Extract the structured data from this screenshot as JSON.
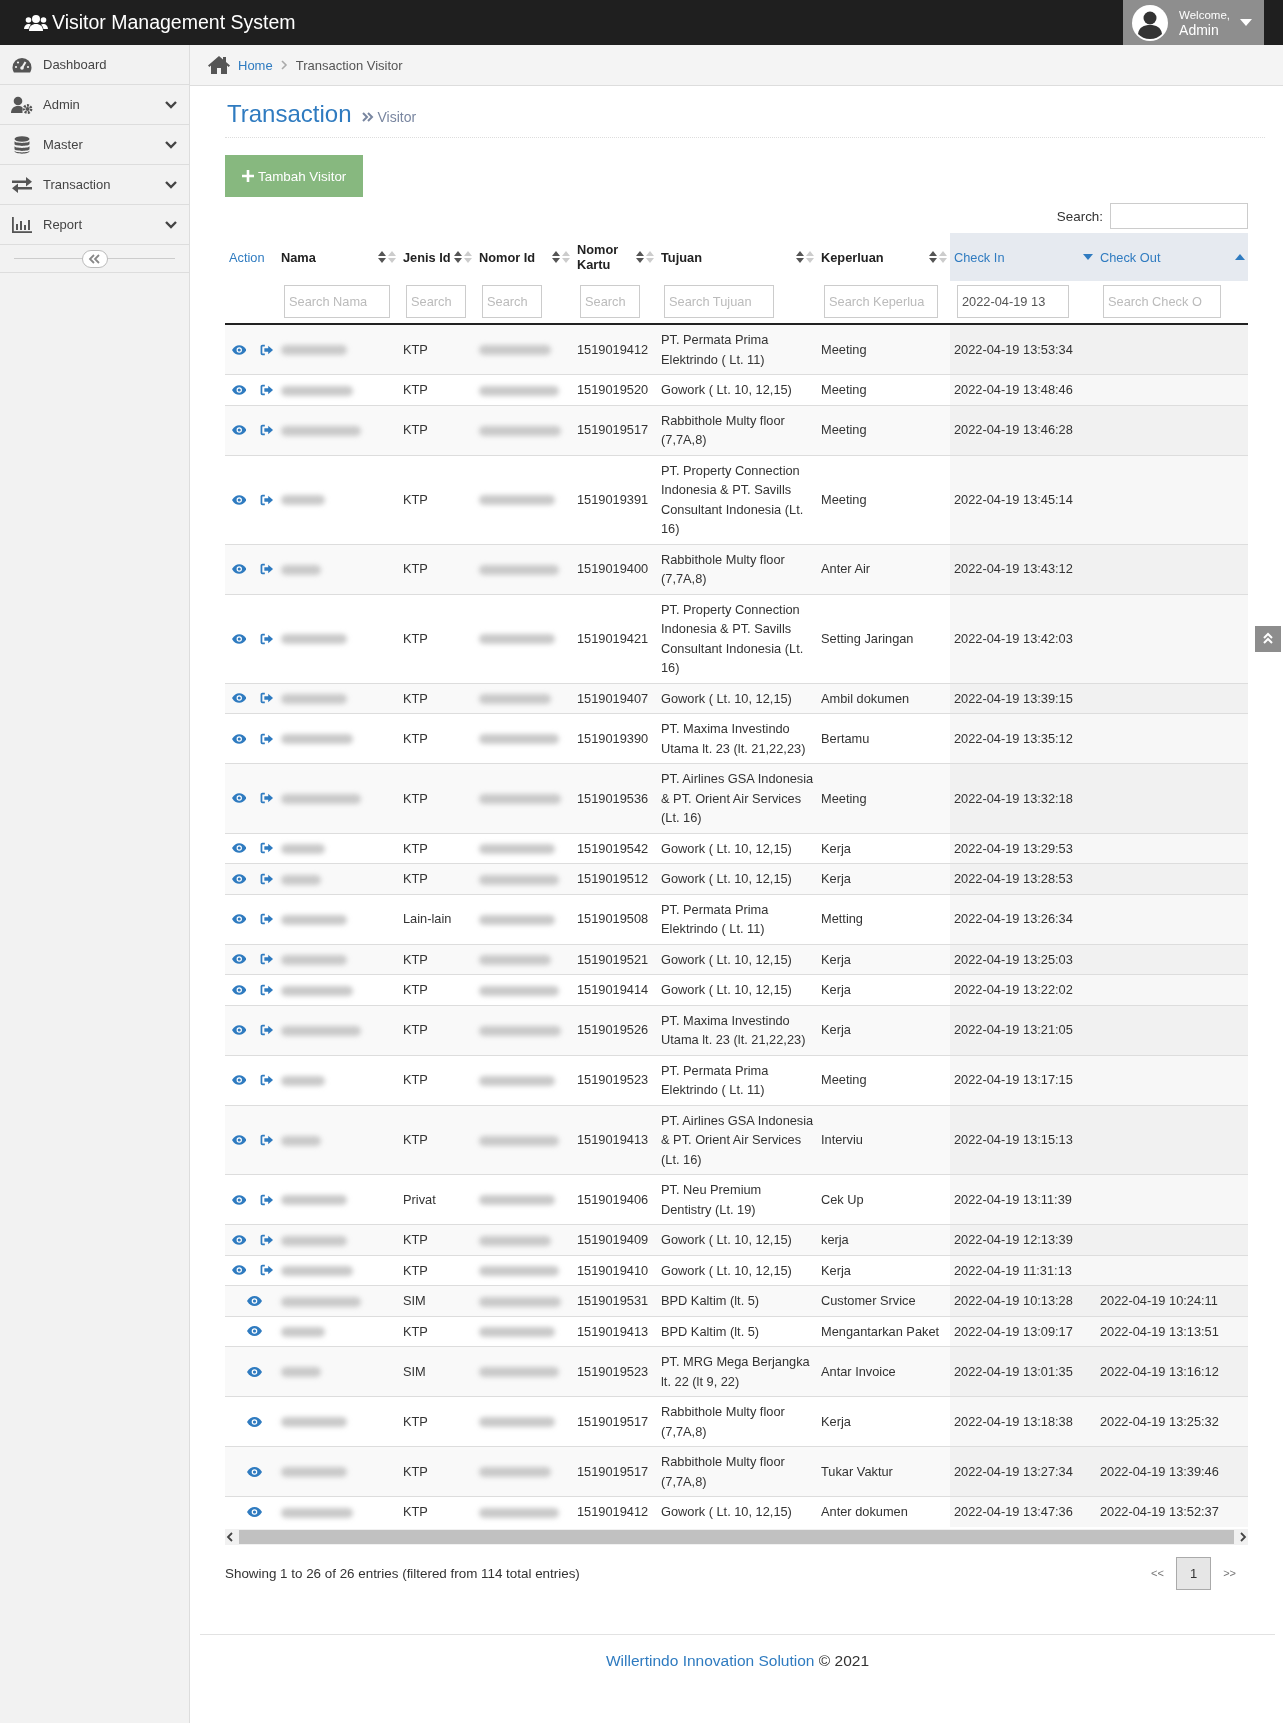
{
  "app": {
    "title": "Visitor Management System"
  },
  "user": {
    "greeting": "Welcome,",
    "name": "Admin"
  },
  "sidebar": {
    "items": [
      {
        "label": "Dashboard",
        "expandable": false
      },
      {
        "label": "Admin",
        "expandable": true
      },
      {
        "label": "Master",
        "expandable": true
      },
      {
        "label": "Transaction",
        "expandable": true
      },
      {
        "label": "Report",
        "expandable": true
      }
    ]
  },
  "breadcrumb": [
    {
      "label": "Home",
      "link": true
    },
    {
      "label": "Transaction Visitor",
      "link": false
    }
  ],
  "page": {
    "title": "Transaction",
    "subtitle": "Visitor"
  },
  "add_button": "Tambah Visitor",
  "search": {
    "label": "Search:"
  },
  "table": {
    "columns": [
      {
        "label": "Action",
        "sortable": false,
        "sorted_ascending": false,
        "sorted_descending": false
      },
      {
        "label": "Nama",
        "sortable": true,
        "sorted_ascending": false,
        "sorted_descending": false,
        "filter": {
          "placeholder": "Search Nama"
        }
      },
      {
        "label": "Jenis Id",
        "sortable": true,
        "sorted_ascending": false,
        "sorted_descending": false,
        "filter": {
          "placeholder": "Search"
        }
      },
      {
        "label": "Nomor Id",
        "sortable": true,
        "sorted_ascending": false,
        "sorted_descending": false,
        "filter": {
          "placeholder": "Search"
        }
      },
      {
        "label": "Nomor Kartu",
        "sortable": true,
        "sorted_ascending": false,
        "sorted_descending": false,
        "filter": {
          "placeholder": "Search"
        }
      },
      {
        "label": "Tujuan",
        "sortable": true,
        "sorted_ascending": false,
        "sorted_descending": false,
        "filter": {
          "placeholder": "Search Tujuan"
        }
      },
      {
        "label": "Keperluan",
        "sortable": true,
        "sorted_ascending": false,
        "sorted_descending": false,
        "filter": {
          "placeholder": "Search Keperlua"
        }
      },
      {
        "label": "Check In",
        "sortable": true,
        "sorted_ascending": false,
        "sorted_descending": true,
        "filter": {
          "value": "2022-04-19 13"
        }
      },
      {
        "label": "Check Out",
        "sortable": true,
        "sorted_ascending": true,
        "sorted_descending": false,
        "filter": {
          "placeholder": "Search Check O"
        }
      }
    ],
    "rows": [
      {
        "redacted": true,
        "can_check_out": true,
        "jenis_id": "KTP",
        "nomor_kartu": "1519019412",
        "tujuan": "PT. Permata Prima Elektrindo ( Lt. 11)",
        "keperluan": "Meeting",
        "check_in": "2022-04-19 13:53:34"
      },
      {
        "redacted": true,
        "can_check_out": true,
        "jenis_id": "KTP",
        "nomor_kartu": "1519019520",
        "tujuan": "Gowork ( Lt. 10, 12,15)",
        "keperluan": "Meeting",
        "check_in": "2022-04-19 13:48:46"
      },
      {
        "redacted": true,
        "can_check_out": true,
        "jenis_id": "KTP",
        "nomor_kartu": "1519019517",
        "tujuan": "Rabbithole Multy floor (7,7A,8)",
        "keperluan": "Meeting",
        "check_in": "2022-04-19 13:46:28"
      },
      {
        "redacted": true,
        "can_check_out": true,
        "jenis_id": "KTP",
        "nomor_kartu": "1519019391",
        "tujuan": "PT. Property Connection Indonesia & PT. Savills Consultant Indonesia (Lt. 16)",
        "keperluan": "Meeting",
        "check_in": "2022-04-19 13:45:14"
      },
      {
        "redacted": true,
        "can_check_out": true,
        "jenis_id": "KTP",
        "nomor_kartu": "1519019400",
        "tujuan": "Rabbithole Multy floor (7,7A,8)",
        "keperluan": "Anter Air",
        "check_in": "2022-04-19 13:43:12"
      },
      {
        "redacted": true,
        "can_check_out": true,
        "jenis_id": "KTP",
        "nomor_kartu": "1519019421",
        "tujuan": "PT. Property Connection Indonesia & PT. Savills Consultant Indonesia (Lt. 16)",
        "keperluan": "Setting Jaringan",
        "check_in": "2022-04-19 13:42:03"
      },
      {
        "redacted": true,
        "can_check_out": true,
        "jenis_id": "KTP",
        "nomor_kartu": "1519019407",
        "tujuan": "Gowork ( Lt. 10, 12,15)",
        "keperluan": "Ambil dokumen",
        "check_in": "2022-04-19 13:39:15"
      },
      {
        "redacted": true,
        "can_check_out": true,
        "jenis_id": "KTP",
        "nomor_kartu": "1519019390",
        "tujuan": "PT. Maxima Investindo Utama lt. 23 (lt. 21,22,23)",
        "keperluan": "Bertamu",
        "check_in": "2022-04-19 13:35:12"
      },
      {
        "redacted": true,
        "can_check_out": true,
        "jenis_id": "KTP",
        "nomor_kartu": "1519019536",
        "tujuan": "PT. Airlines GSA Indonesia & PT. Orient Air Services (Lt. 16)",
        "keperluan": "Meeting",
        "check_in": "2022-04-19 13:32:18"
      },
      {
        "redacted": true,
        "can_check_out": true,
        "jenis_id": "KTP",
        "nomor_kartu": "1519019542",
        "tujuan": "Gowork ( Lt. 10, 12,15)",
        "keperluan": "Kerja",
        "check_in": "2022-04-19 13:29:53"
      },
      {
        "redacted": true,
        "can_check_out": true,
        "jenis_id": "KTP",
        "nomor_kartu": "1519019512",
        "tujuan": "Gowork ( Lt. 10, 12,15)",
        "keperluan": "Kerja",
        "check_in": "2022-04-19 13:28:53"
      },
      {
        "redacted": true,
        "can_check_out": true,
        "jenis_id": "Lain-lain",
        "nomor_kartu": "1519019508",
        "tujuan": "PT. Permata Prima Elektrindo ( Lt. 11)",
        "keperluan": "Metting",
        "check_in": "2022-04-19 13:26:34"
      },
      {
        "redacted": true,
        "can_check_out": true,
        "jenis_id": "KTP",
        "nomor_kartu": "1519019521",
        "tujuan": "Gowork ( Lt. 10, 12,15)",
        "keperluan": "Kerja",
        "check_in": "2022-04-19 13:25:03"
      },
      {
        "redacted": true,
        "can_check_out": true,
        "jenis_id": "KTP",
        "nomor_kartu": "1519019414",
        "tujuan": "Gowork ( Lt. 10, 12,15)",
        "keperluan": "Kerja",
        "check_in": "2022-04-19 13:22:02"
      },
      {
        "redacted": true,
        "can_check_out": true,
        "jenis_id": "KTP",
        "nomor_kartu": "1519019526",
        "tujuan": "PT. Maxima Investindo Utama lt. 23 (lt. 21,22,23)",
        "keperluan": "Kerja",
        "check_in": "2022-04-19 13:21:05"
      },
      {
        "redacted": true,
        "can_check_out": true,
        "jenis_id": "KTP",
        "nomor_kartu": "1519019523",
        "tujuan": "PT. Permata Prima Elektrindo ( Lt. 11)",
        "keperluan": "Meeting",
        "check_in": "2022-04-19 13:17:15"
      },
      {
        "redacted": true,
        "can_check_out": true,
        "jenis_id": "KTP",
        "nomor_kartu": "1519019413",
        "tujuan": "PT. Airlines GSA Indonesia & PT. Orient Air Services (Lt. 16)",
        "keperluan": "Interviu",
        "check_in": "2022-04-19 13:15:13"
      },
      {
        "redacted": true,
        "can_check_out": true,
        "jenis_id": "Privat",
        "nomor_kartu": "1519019406",
        "tujuan": "PT. Neu Premium Dentistry (Lt. 19)",
        "keperluan": "Cek Up",
        "check_in": "2022-04-19 13:11:39"
      },
      {
        "redacted": true,
        "can_check_out": true,
        "jenis_id": "KTP",
        "nomor_kartu": "1519019409",
        "tujuan": "Gowork ( Lt. 10, 12,15)",
        "keperluan": "kerja",
        "check_in": "2022-04-19 12:13:39"
      },
      {
        "redacted": true,
        "can_check_out": true,
        "jenis_id": "KTP",
        "nomor_kartu": "1519019410",
        "tujuan": "Gowork ( Lt. 10, 12,15)",
        "keperluan": "Kerja",
        "check_in": "2022-04-19 11:31:13"
      },
      {
        "redacted": true,
        "can_check_out": false,
        "jenis_id": "SIM",
        "nomor_kartu": "1519019531",
        "tujuan": "BPD Kaltim (lt. 5)",
        "keperluan": "Customer Srvice",
        "check_in": "2022-04-19 10:13:28",
        "check_out": "2022-04-19 10:24:11"
      },
      {
        "redacted": true,
        "can_check_out": false,
        "jenis_id": "KTP",
        "nomor_kartu": "1519019413",
        "tujuan": "BPD Kaltim (lt. 5)",
        "keperluan": "Mengantarkan Paket",
        "check_in": "2022-04-19 13:09:17",
        "check_out": "2022-04-19 13:13:51"
      },
      {
        "redacted": true,
        "can_check_out": false,
        "jenis_id": "SIM",
        "nomor_kartu": "1519019523",
        "tujuan": "PT. MRG Mega Berjangka lt. 22 (lt 9, 22)",
        "keperluan": "Antar Invoice",
        "check_in": "2022-04-19 13:01:35",
        "check_out": "2022-04-19 13:16:12"
      },
      {
        "redacted": true,
        "can_check_out": false,
        "jenis_id": "KTP",
        "nomor_kartu": "1519019517",
        "tujuan": "Rabbithole Multy floor (7,7A,8)",
        "keperluan": "Kerja",
        "check_in": "2022-04-19 13:18:38",
        "check_out": "2022-04-19 13:25:32"
      },
      {
        "redacted": true,
        "can_check_out": false,
        "jenis_id": "KTP",
        "nomor_kartu": "1519019517",
        "tujuan": "Rabbithole Multy floor (7,7A,8)",
        "keperluan": "Tukar Vaktur",
        "check_in": "2022-04-19 13:27:34",
        "check_out": "2022-04-19 13:39:46"
      },
      {
        "redacted": true,
        "can_check_out": false,
        "jenis_id": "KTP",
        "nomor_kartu": "1519019412",
        "tujuan": "Gowork ( Lt. 10, 12,15)",
        "keperluan": "Anter dokumen",
        "check_in": "2022-04-19 13:47:36",
        "check_out": "2022-04-19 13:52:37"
      }
    ]
  },
  "info": "Showing 1 to 26 of 26 entries (filtered from 114 total entries)",
  "pagination": {
    "prev": "<<",
    "pages": [
      {
        "label": "1",
        "selected": true
      }
    ],
    "next": ">>"
  },
  "footer": {
    "company": "Willertindo Innovation Solution",
    "copyright": "© 2021"
  }
}
